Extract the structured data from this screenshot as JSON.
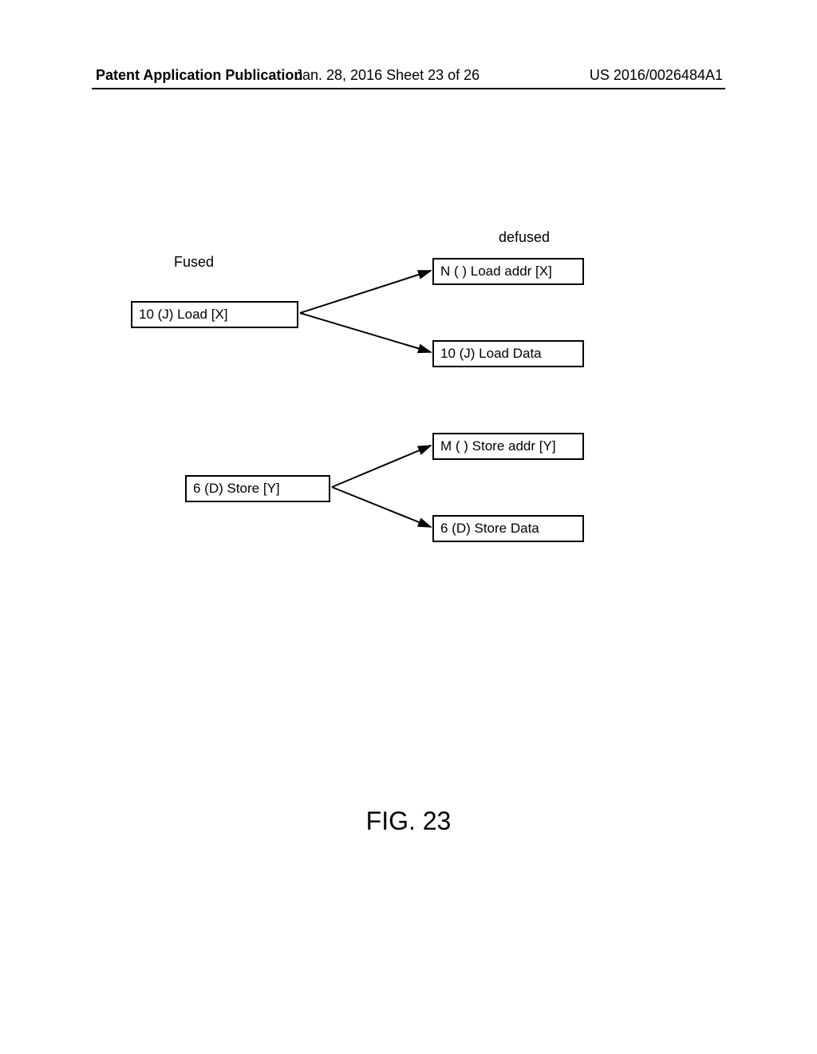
{
  "header": {
    "left": "Patent Application Publication",
    "center": "Jan. 28, 2016  Sheet 23 of 26",
    "right": "US 2016/0026484A1"
  },
  "labels": {
    "fused": "Fused",
    "defused": "defused"
  },
  "boxes": {
    "fused_load": "10  (J) Load   [X]",
    "load_addr": "N ( ) Load addr [X]",
    "load_data": "10  (J) Load Data",
    "fused_store": "6  (D) Store  [Y]",
    "store_addr": "M ( ) Store addr [Y]",
    "store_data": "6  (D) Store Data"
  },
  "figure_caption": "FIG. 23"
}
